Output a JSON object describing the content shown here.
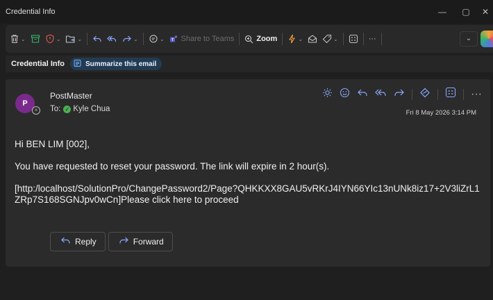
{
  "window": {
    "title": "Credential Info",
    "minimize": "—",
    "maximize": "▢",
    "close": "✕"
  },
  "ribbon": {
    "share_label": "Share to Teams",
    "zoom_label": "Zoom",
    "more_label": "···",
    "caret": "⌄"
  },
  "subject_bar": {
    "subject": "Credential Info",
    "summarize_label": "Summarize this email"
  },
  "message": {
    "avatar_initial": "P",
    "sender": "PostMaster",
    "to_prefix": "To:",
    "recipient": "Kyle Chua",
    "date": "Fri 8 May 2026 3:14 PM",
    "greeting": "Hi BEN LIM [002],",
    "paragraph": "You have requested to reset your password. The link will expire in 2 hour(s).",
    "link_text": "[http:/localhost/SolutionPro/ChangePassword2/Page?QHKKXX8GAU5vRKrJ4IYN66YIc13nUNk8iz17+2V3liZrL1ZRp7S168SGNJpv0wCn]Please click here to proceed",
    "more_label": "···"
  },
  "buttons": {
    "reply_label": "Reply",
    "forward_label": "Forward"
  },
  "colors": {
    "accent": "#8aa9ff",
    "avatar_bg": "#7a2a8c",
    "presence_check": "#4caf50",
    "summarize_bg": "#223b52"
  }
}
